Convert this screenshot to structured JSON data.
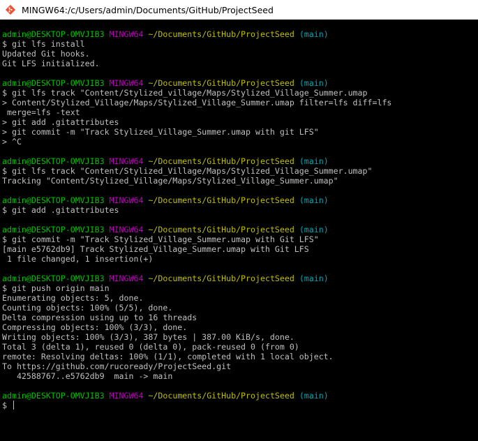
{
  "window": {
    "title": "MINGW64:/c/Users/admin/Documents/GitHub/ProjectSeed",
    "icon": "git-bash-icon"
  },
  "prompt": {
    "user_host": "admin@DESKTOP-OMVJIB3",
    "system": "MINGW64",
    "path": "~/Documents/GitHub/ProjectSeed",
    "branch": "(main)"
  },
  "colors": {
    "background": "#000000",
    "text": "#c0c0c0",
    "user_host": "#00c000",
    "system": "#bf00bf",
    "path": "#bfbf00",
    "branch": "#00a6b2"
  },
  "lines": [
    {
      "type": "prompt"
    },
    {
      "type": "text",
      "text": "$ git lfs install"
    },
    {
      "type": "text",
      "text": "Updated Git hooks."
    },
    {
      "type": "text",
      "text": "Git LFS initialized."
    },
    {
      "type": "blank"
    },
    {
      "type": "prompt"
    },
    {
      "type": "text",
      "text": "$ git lfs track \"Content/Stylized_village/Maps/Stylized_Village_Summer.umap"
    },
    {
      "type": "text",
      "text": "> Content/Stylized_Village/Maps/Stylized_Village_Summer.umap filter=lfs diff=lfs"
    },
    {
      "type": "text",
      "text": " merge=lfs -text"
    },
    {
      "type": "text",
      "text": "> git add .gitattributes"
    },
    {
      "type": "text",
      "text": "> git commit -m \"Track Stylized_Village_Summer.umap with git LFS\""
    },
    {
      "type": "text",
      "text": "> ^C"
    },
    {
      "type": "blank"
    },
    {
      "type": "prompt"
    },
    {
      "type": "text",
      "text": "$ git lfs track \"Content/Stylized_Village/Maps/Stylized_Village_Summer.umap\""
    },
    {
      "type": "text",
      "text": "Tracking \"Content/Stylized_Village/Maps/Stylized_Village_Summer.umap\""
    },
    {
      "type": "blank"
    },
    {
      "type": "prompt"
    },
    {
      "type": "text",
      "text": "$ git add .gitattributes"
    },
    {
      "type": "blank"
    },
    {
      "type": "prompt"
    },
    {
      "type": "text",
      "text": "$ git commit -m \"Track Stylized_Village_Summer.umap with Git LFS\""
    },
    {
      "type": "text",
      "text": "[main e5762db9] Track Stylized_Village_Summer.umap with Git LFS"
    },
    {
      "type": "text",
      "text": " 1 file changed, 1 insertion(+)"
    },
    {
      "type": "blank"
    },
    {
      "type": "prompt"
    },
    {
      "type": "text",
      "text": "$ git push origin main"
    },
    {
      "type": "text",
      "text": "Enumerating objects: 5, done."
    },
    {
      "type": "text",
      "text": "Counting objects: 100% (5/5), done."
    },
    {
      "type": "text",
      "text": "Delta compression using up to 16 threads"
    },
    {
      "type": "text",
      "text": "Compressing objects: 100% (3/3), done."
    },
    {
      "type": "text",
      "text": "Writing objects: 100% (3/3), 387 bytes | 387.00 KiB/s, done."
    },
    {
      "type": "text",
      "text": "Total 3 (delta 1), reused 0 (delta 0), pack-reused 0 (from 0)"
    },
    {
      "type": "text",
      "text": "remote: Resolving deltas: 100% (1/1), completed with 1 local object."
    },
    {
      "type": "text",
      "text": "To https://github.com/rucoready/ProjectSeed.git"
    },
    {
      "type": "text",
      "text": "   42588767..e5762db9  main -> main"
    },
    {
      "type": "blank"
    },
    {
      "type": "prompt"
    },
    {
      "type": "input",
      "text": "$ "
    }
  ]
}
